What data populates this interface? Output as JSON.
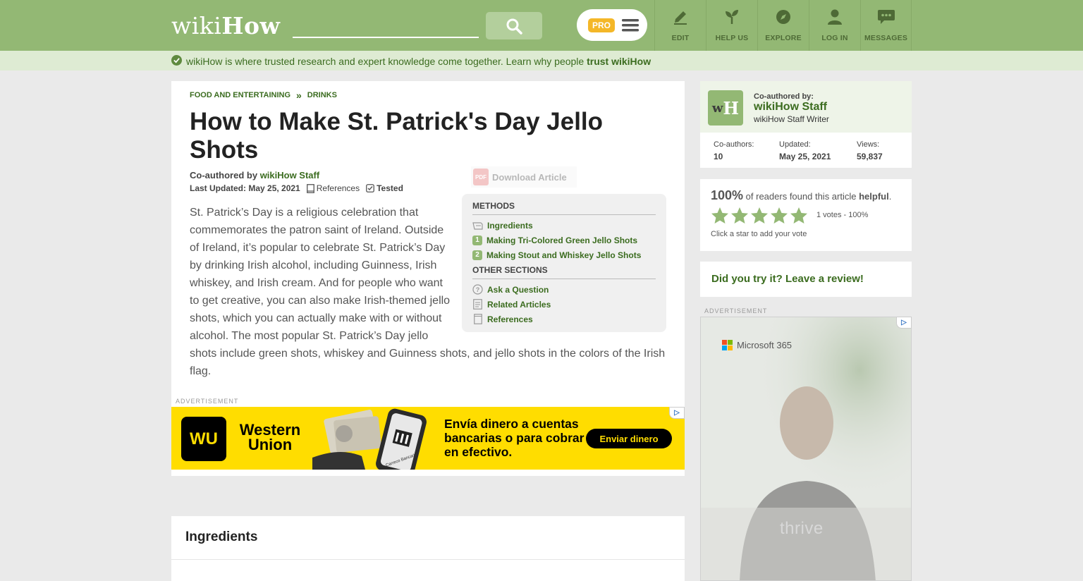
{
  "header": {
    "logo_wiki": "wiki",
    "logo_how": "How",
    "search_placeholder": "",
    "pro_label": "PRO",
    "nav": [
      {
        "label": "EDIT",
        "icon": "pencil-icon"
      },
      {
        "label": "HELP US",
        "icon": "sprout-icon"
      },
      {
        "label": "EXPLORE",
        "icon": "compass-icon"
      },
      {
        "label": "LOG IN",
        "icon": "user-icon"
      },
      {
        "label": "MESSAGES",
        "icon": "chat-icon"
      }
    ]
  },
  "trust_bar": {
    "text": "wikiHow is where trusted research and expert knowledge come together. Learn why people",
    "link": "trust wikiHow"
  },
  "breadcrumb": [
    "FOOD AND ENTERTAINING",
    "DRINKS"
  ],
  "article": {
    "title": "How to Make St. Patrick's Day Jello Shots",
    "coauthored_prefix": "Co-authored by",
    "author": "wikiHow Staff",
    "last_updated": "Last Updated: May 25, 2021",
    "references_label": "References",
    "tested_label": "Tested",
    "download_label": "Download Article",
    "pdf_label": "PDF",
    "intro": "St. Patrick’s Day is a religious celebration that commemorates the patron saint of Ireland. Outside of Ireland, it’s popular to celebrate St. Patrick’s Day by drinking Irish alcohol, including Guinness, Irish whiskey, and Irish cream. And for people who want to get creative, you can also make Irish-themed jello shots, which you can actually make with or without alcohol. The most popular St. Patrick’s Day jello shots include green shots, whiskey and Guinness shots, and jello shots in the colors of the Irish flag."
  },
  "toc": {
    "methods_heading": "METHODS",
    "methods": [
      {
        "num": "",
        "label": "Ingredients",
        "icon": "list-icon"
      },
      {
        "num": "1",
        "label": "Making Tri-Colored Green Jello Shots"
      },
      {
        "num": "2",
        "label": "Making Stout and Whiskey Jello Shots"
      }
    ],
    "other_heading": "OTHER SECTIONS",
    "other": [
      {
        "label": "Ask a Question",
        "icon": "question-icon"
      },
      {
        "label": "Related Articles",
        "icon": "document-icon"
      },
      {
        "label": "References",
        "icon": "book-icon"
      }
    ]
  },
  "ads": {
    "label": "ADVERTISEMENT",
    "adchoices_label": "▷",
    "banner": {
      "logo": "WU",
      "brand": "Western Union",
      "text": "Envía dinero a cuentas bancarias o para cobrar en efectivo.",
      "cta": "Enviar dinero",
      "phone_text": "Carreco Bancario"
    },
    "side": {
      "brand": "Microsoft 365",
      "tagline": "thrive"
    }
  },
  "sections": {
    "ingredients_heading": "Ingredients"
  },
  "author_card": {
    "by_label": "Co-authored by:",
    "name": "wikiHow Staff",
    "role": "wikiHow Staff Writer",
    "avatar_w": "w",
    "avatar_h": "H",
    "stats": [
      {
        "label": "Co-authors:",
        "value": "10"
      },
      {
        "label": "Updated:",
        "value": "May 25, 2021"
      },
      {
        "label": "Views:",
        "value": "59,837"
      }
    ]
  },
  "rating": {
    "percent": "100%",
    "text": "of readers found this article",
    "helpful": "helpful",
    "period": ".",
    "stars_filled": 5,
    "votes": "1 votes - 100%",
    "click_hint": "Click a star to add your vote"
  },
  "review": {
    "link": "Did you try it? Leave a review!"
  },
  "colors": {
    "header_green": "#93b874",
    "link_green": "#3b6c1f",
    "trust_bg": "#deebd3",
    "pro_yellow": "#f4b728",
    "wu_yellow": "#ffdd00"
  }
}
